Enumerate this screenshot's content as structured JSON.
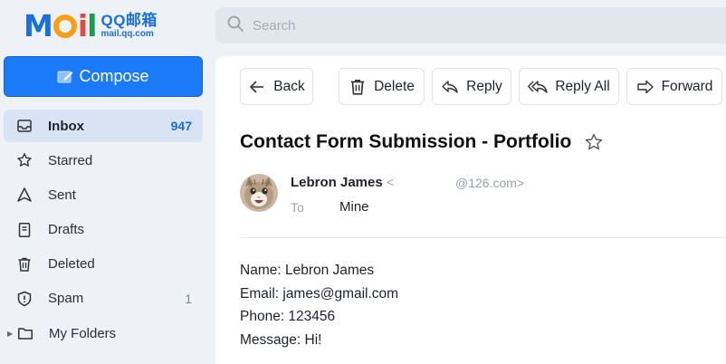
{
  "logo": {
    "word_m": "M",
    "word_i": "i",
    "word_l": "l",
    "chinese": "QQ邮箱",
    "domain": "mail.qq.com"
  },
  "search": {
    "placeholder": "Search"
  },
  "compose": {
    "label": "Compose"
  },
  "sidebar": {
    "items": [
      {
        "label": "Inbox",
        "count": "947",
        "icon": "inbox-icon"
      },
      {
        "label": "Starred",
        "count": "",
        "icon": "star-icon"
      },
      {
        "label": "Sent",
        "count": "",
        "icon": "sent-icon"
      },
      {
        "label": "Drafts",
        "count": "",
        "icon": "drafts-icon"
      },
      {
        "label": "Deleted",
        "count": "",
        "icon": "trash-icon"
      },
      {
        "label": "Spam",
        "count": "1",
        "icon": "spam-shield-icon"
      },
      {
        "label": "My Folders",
        "count": "",
        "icon": "folder-icon"
      }
    ]
  },
  "toolbar": {
    "back": "Back",
    "delete": "Delete",
    "reply": "Reply",
    "reply_all": "Reply All",
    "forward": "Forward"
  },
  "message": {
    "subject": "Contact Form Submission - Portfolio",
    "from_name": "Lebron James",
    "from_open": "<",
    "from_address": "@126.com>",
    "to_label": "To",
    "to_value": "Mine",
    "body_lines": [
      "Name: Lebron James",
      "Email: james@gmail.com",
      "Phone: 123456",
      "Message: Hi!"
    ]
  },
  "colors": {
    "accent": "#1a7af8",
    "sidebar_active": "#d8e3f3",
    "background": "#eef1f6"
  }
}
